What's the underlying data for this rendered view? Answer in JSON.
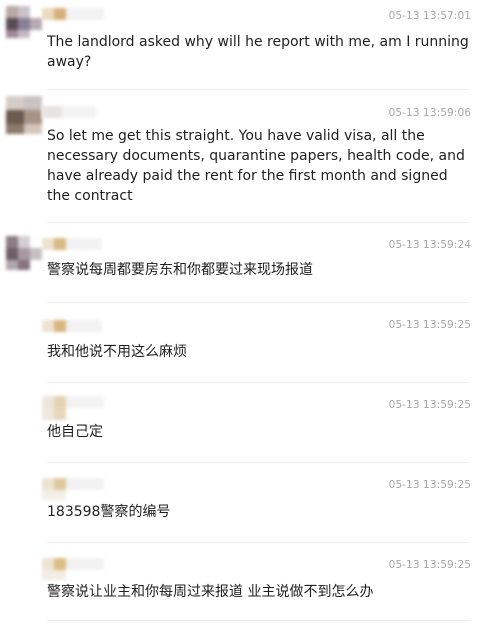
{
  "comments": [
    {
      "timestamp": "05-13 13:57:01",
      "text": "The landlord asked why will he report with me, am I running away?"
    },
    {
      "timestamp": "05-13 13:59:06",
      "text": "So let me get this straight. You have valid visa, all the necessary documents, quarantine papers, health code, and have already paid the rent for the first month and signed the contract"
    },
    {
      "timestamp": "05-13 13:59:24",
      "text": "警察说每周都要房东和你都要过来现场报道"
    },
    {
      "timestamp": "05-13 13:59:25",
      "text": "我和他说不用这么麻烦"
    },
    {
      "timestamp": "05-13 13:59:25",
      "text": "他自己定"
    },
    {
      "timestamp": "05-13 13:59:25",
      "text": "183598警察的编号"
    },
    {
      "timestamp": "05-13 13:59:25",
      "text": "警察说让业主和你每周过来报道 业主说做不到怎么办"
    }
  ],
  "colors": {
    "timestamp": "#a6a6a6",
    "text": "#1f1f1f",
    "divider": "#ececec"
  }
}
